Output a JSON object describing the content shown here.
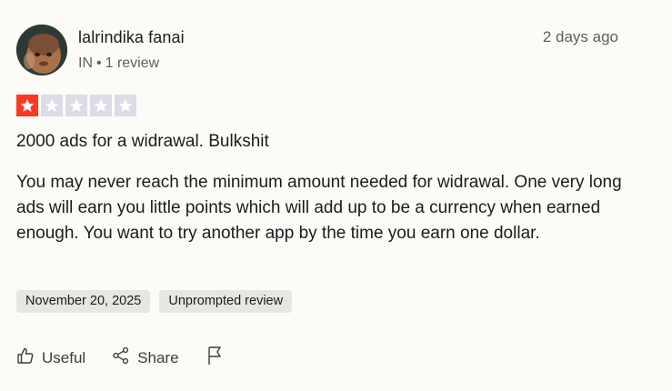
{
  "reviewer": {
    "name": "lalrindika fanai",
    "country": "IN",
    "separator": "•",
    "review_count": "1 review",
    "date_ago": "2 days ago"
  },
  "rating": {
    "value": 1,
    "max": 5,
    "filled_color": "#ff3722",
    "empty_color": "#dcdce6"
  },
  "review": {
    "title": "2000 ads for a widrawal. Bulkshit",
    "body": "You may never reach the minimum amount needed for widrawal. One very long ads will earn you little points which will add up to be a currency when earned enough. You want to try another app by the time you earn one dollar."
  },
  "tags": {
    "date": "November 20, 2025",
    "type": "Unprompted review"
  },
  "actions": {
    "useful": "Useful",
    "share": "Share"
  }
}
